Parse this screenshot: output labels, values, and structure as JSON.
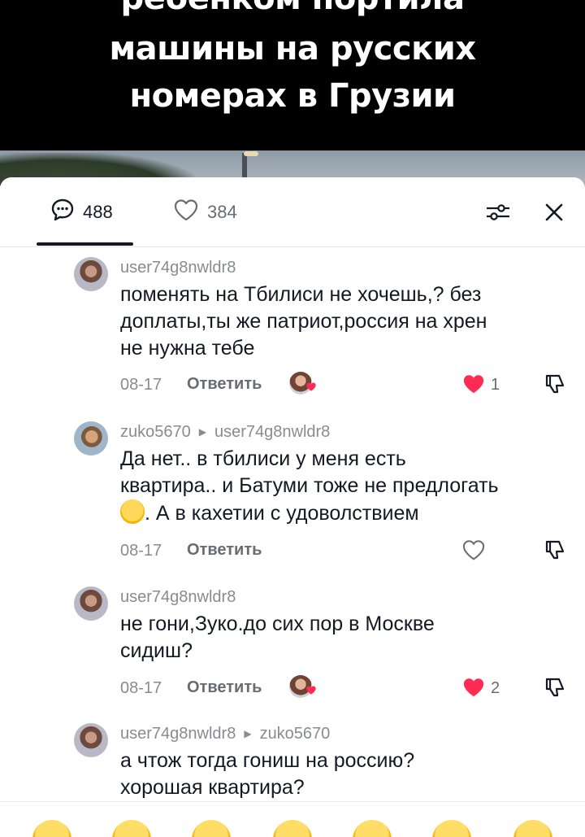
{
  "video": {
    "caption_lines": [
      "ребенком портила",
      "машины на русских",
      "номерах в Грузии"
    ]
  },
  "header": {
    "comments_count": "488",
    "likes_count": "384"
  },
  "comments": [
    {
      "author": "user74g8nwldr8",
      "reply_to": "",
      "text_lines": [
        "поменять на Тбилиси не хочешь,? без",
        "доплаты,ты же патриот,россия на хрен",
        "не нужна тебе"
      ],
      "date": "08-17",
      "reply_label": "Ответить",
      "liked": true,
      "like_count": "1",
      "creator_liked": true
    },
    {
      "author": "zuko5670",
      "reply_to": "user74g8nwldr8",
      "text_lines": [
        "Да нет.. в тбилиси у меня есть",
        "квартира.. и Батуми тоже не предлогать",
        ". А в кахетии с удоволствием"
      ],
      "date": "08-17",
      "reply_label": "Ответить",
      "liked": false,
      "like_count": "",
      "creator_liked": false
    },
    {
      "author": "user74g8nwldr8",
      "reply_to": "",
      "text_lines": [
        "не гони,Зуко.до сих пор в Москве",
        "сидиш?"
      ],
      "date": "08-17",
      "reply_label": "Ответить",
      "liked": true,
      "like_count": "2",
      "creator_liked": true
    },
    {
      "author": "user74g8nwldr8",
      "reply_to": "zuko5670",
      "text_lines": [
        "а чтож тогда гониш на россию?",
        "хорошая квартира?"
      ],
      "date": "",
      "reply_label": "",
      "liked": false,
      "like_count": "",
      "creator_liked": false
    }
  ],
  "icons": {
    "comments_tab": "speech-bubble-icon",
    "likes_tab": "heart-outline-icon",
    "filter": "sliders-icon",
    "close": "close-icon",
    "like": "heart-icon",
    "dislike": "thumbs-down-icon"
  },
  "colors": {
    "like_red": "#fe2c55",
    "text_primary": "#161823",
    "text_secondary": "#8a8b91"
  },
  "emoji_bar": [
    "grinning-sweat-emoji",
    "heart-eyes-emoji",
    "smiling-emoji",
    "sweat-smile-emoji",
    "laughing-emoji",
    "clapping-emoji",
    "grimacing-emoji"
  ]
}
